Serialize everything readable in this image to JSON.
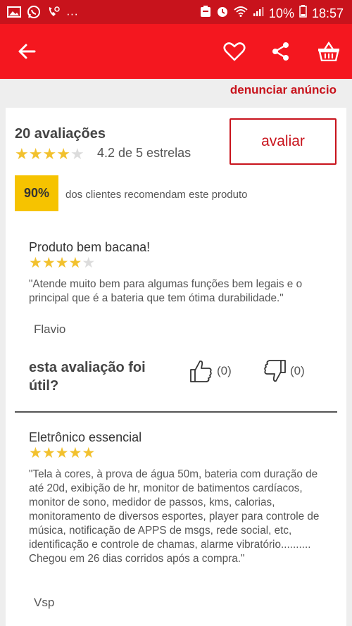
{
  "status_bar": {
    "battery_pct": "10%",
    "time": "18:57",
    "more": "···"
  },
  "app_bar": {
    "back_icon": "arrow-left-icon",
    "favorite_icon": "heart-outline-icon",
    "share_icon": "share-icon",
    "cart_icon": "basket-icon",
    "accent_color": "#f4171f"
  },
  "report_label": "denunciar anúncio",
  "summary": {
    "count_label": "20 avaliações",
    "rating": 4.2,
    "stars_filled": 4,
    "rating_text": "4.2 de 5 estrelas",
    "rate_button": "avaliar",
    "recommend_pct": "90%",
    "recommend_text": "dos clientes recomendam este produto"
  },
  "reviews": [
    {
      "title": "Produto bem bacana!",
      "stars": 4,
      "body": "\"Atende muito bem para algumas funções bem legais e o principal que é a bateria que tem ótima durabilidade.\"",
      "author": "Flavio",
      "helpful_question": "esta avaliação foi útil?",
      "up_count": "(0)",
      "down_count": "(0)"
    },
    {
      "title": "Eletrônico essencial",
      "stars": 5,
      "body": "\"Tela à cores, à prova de água 50m, bateria com duração de até 20d, exibição de hr, monitor de batimentos cardíacos, monitor de sono, medidor de passos, kms, calorias, monitoramento de diversos esportes, player para controle de música, notificação de APPS de msgs, rede social, etc, identificação e controle de chamas, alarme vibratório.......... Chegou em 26 dias corridos após a compra.\"",
      "author": "Vsp"
    }
  ]
}
